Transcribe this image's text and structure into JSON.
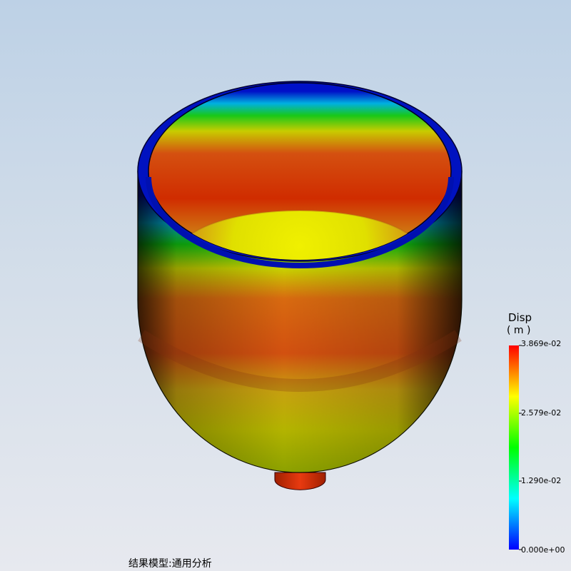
{
  "legend": {
    "title": "Disp",
    "unit": "( m )",
    "ticks": [
      "3.869e-02",
      "2.579e-02",
      "1.290e-02",
      "0.000e+00"
    ],
    "colors": [
      "#ff0000",
      "#ffff00",
      "#00ff00",
      "#00ffff",
      "#0000ff"
    ]
  },
  "status": {
    "model_label": "结果模型:通用分析"
  },
  "colors": {
    "deep_blue": "#0010c8",
    "high_red": "#d42a00",
    "mid_yellow": "#e8e400"
  }
}
